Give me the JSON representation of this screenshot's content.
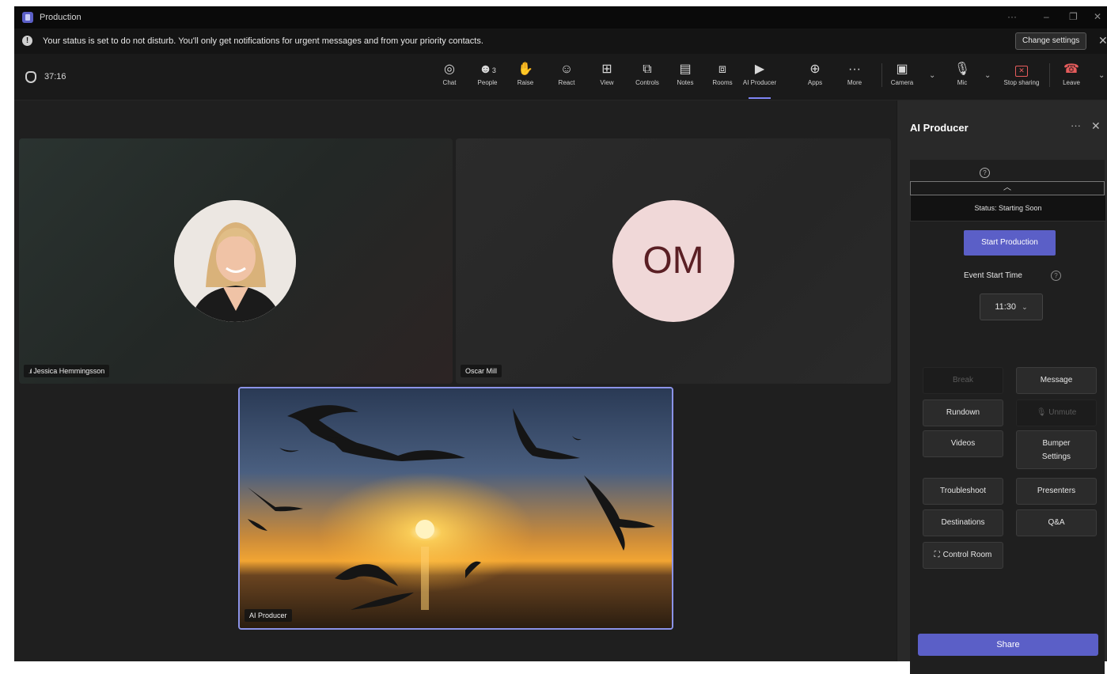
{
  "window": {
    "title": "Production",
    "controls": {
      "more": "···",
      "minimize": "–",
      "restore": "❐",
      "close": "✕"
    }
  },
  "banner": {
    "message": "Your status is set to do not disturb. You'll only get notifications for urgent messages and from your priority contacts.",
    "action": "Change settings",
    "close": "✕"
  },
  "meeting": {
    "timer": "37:16"
  },
  "toolbar": {
    "items": [
      {
        "label": "Chat",
        "icon": "chat-icon",
        "glyph": "💬"
      },
      {
        "label": "People",
        "icon": "people-icon",
        "glyph": "👤",
        "count": "3"
      },
      {
        "label": "Raise",
        "icon": "raise-hand-icon",
        "glyph": "✋"
      },
      {
        "label": "React",
        "icon": "react-icon",
        "glyph": "☺"
      },
      {
        "label": "View",
        "icon": "view-icon",
        "glyph": "⊞"
      },
      {
        "label": "Controls",
        "icon": "controls-icon",
        "glyph": "⧉"
      },
      {
        "label": "Notes",
        "icon": "notes-icon",
        "glyph": "▤"
      },
      {
        "label": "Rooms",
        "icon": "rooms-icon",
        "glyph": "⧈"
      },
      {
        "label": "AI Producer",
        "icon": "ai-producer-icon",
        "glyph": "▶",
        "active": true
      },
      {
        "label": "Apps",
        "icon": "apps-icon",
        "glyph": "⊕"
      },
      {
        "label": "More",
        "icon": "more-icon",
        "glyph": "···"
      }
    ],
    "camera": "Camera",
    "mic": "Mic",
    "stop_sharing": "Stop sharing",
    "leave": "Leave"
  },
  "participants": [
    {
      "name": "Jessica Hemmingsson",
      "has_photo": true
    },
    {
      "name": "Oscar Mill",
      "initials": "OM"
    },
    {
      "name": "AI Producer",
      "content": "sunset-with-birds"
    }
  ],
  "panel": {
    "title": "AI Producer",
    "status": "Status: Starting Soon",
    "start_button": "Start Production",
    "event_start_label": "Event Start Time",
    "event_start_time": "11:30",
    "buttons": {
      "break": "Break",
      "message": "Message",
      "rundown": "Rundown",
      "unmute": "Unmute",
      "videos": "Videos",
      "bumper_settings_1": "Bumper",
      "bumper_settings_2": "Settings",
      "troubleshoot": "Troubleshoot",
      "presenters": "Presenters",
      "destinations": "Destinations",
      "qa": "Q&A",
      "control_room": "Control Room"
    },
    "share": "Share"
  },
  "colors": {
    "accent": "#5b5fc7",
    "leave": "#e65c5c",
    "om_avatar_bg": "#f0d8d8",
    "om_avatar_text": "#5a1f24"
  }
}
